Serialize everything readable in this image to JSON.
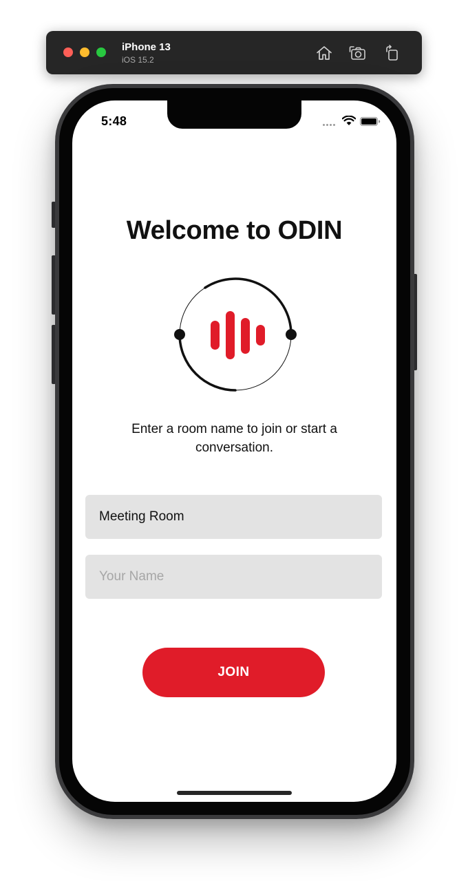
{
  "simulator": {
    "device_name": "iPhone 13",
    "os_version": "iOS 15.2",
    "icons": [
      "home-icon",
      "screenshot-camera-icon",
      "rotate-icon"
    ]
  },
  "status_bar": {
    "time": "5:48",
    "icons": [
      "signal-dots-icon",
      "wifi-icon",
      "battery-icon"
    ]
  },
  "main": {
    "title": "Welcome to ODIN",
    "logo": "odin-voice-logo",
    "instruction": "Enter a room name to join or start a conversation.",
    "room_field": {
      "value": "Meeting Room",
      "placeholder": ""
    },
    "name_field": {
      "value": "",
      "placeholder": "Your Name"
    },
    "join_label": "JOIN"
  },
  "colors": {
    "accent": "#e01c29",
    "field_background": "#e3e3e3",
    "text": "#111111",
    "placeholder": "#a6a6a6"
  }
}
